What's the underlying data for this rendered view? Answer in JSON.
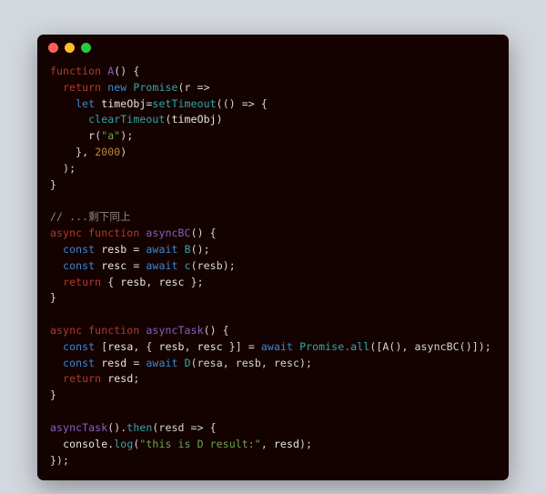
{
  "code": {
    "line1": {
      "kw": "function",
      "name": "A",
      "open": "() {"
    },
    "line2": {
      "kw": "return",
      "new": "new",
      "type": "Promise",
      "rest": "(r =>"
    },
    "line3": {
      "let": "let",
      "id": "timeObj",
      "eq": "=",
      "fn": "setTimeout",
      "rest": "(() => {"
    },
    "line4": {
      "fn": "clearTimeout",
      "arg": "timeObj",
      "close": ")"
    },
    "line5": {
      "fn": "r",
      "open": "(",
      "str": "\"a\"",
      "close": ");"
    },
    "line6": {
      "close": "}, ",
      "num": "2000",
      "paren": ")"
    },
    "line7": {
      "close": ");"
    },
    "line8": {
      "close": "}"
    },
    "line9": {
      "cmt": "// ...剩下同上"
    },
    "line10": {
      "async": "async",
      "func": "function",
      "name": "asyncBC",
      "open": "() {"
    },
    "line11": {
      "const": "const",
      "id": "resb",
      "eq": " = ",
      "await": "await",
      "call": "B",
      "rest": "();"
    },
    "line12": {
      "const": "const",
      "id": "resc",
      "eq": " = ",
      "await": "await",
      "call": "c",
      "rest": "(resb);"
    },
    "line13": {
      "ret": "return",
      "open": " { ",
      "a": "resb",
      "sep": ", ",
      "b": "resc",
      "close": " };"
    },
    "line14": {
      "close": "}"
    },
    "line15": {
      "async": "async",
      "func": "function",
      "name": "asyncTask",
      "open": "() {"
    },
    "line16": {
      "const": "const",
      "open": " [",
      "a": "resa",
      "sep1": ", { ",
      "b": "resb",
      "sep2": ", ",
      "c": "resc",
      "close1": " }] = ",
      "await": "await",
      "prom": "Promise",
      "all": ".all",
      "rest": "([A(), asyncBC()]);"
    },
    "line17": {
      "const": "const",
      "id": "resd",
      "eq": " = ",
      "await": "await",
      "call": "D",
      "rest": "(resa, resb, resc);"
    },
    "line18": {
      "ret": "return",
      "id": " resd",
      "close": ";"
    },
    "line19": {
      "close": "}"
    },
    "line20": {
      "fn": "asyncTask",
      "rest1": "().",
      "then": "then",
      "rest2": "(resd => {"
    },
    "line21": {
      "obj": "console",
      "dot": ".",
      "log": "log",
      "open": "(",
      "str": "\"this is D result:\"",
      "sep": ", ",
      "id": "resd",
      "close": ");"
    },
    "line22": {
      "close": "});"
    }
  }
}
